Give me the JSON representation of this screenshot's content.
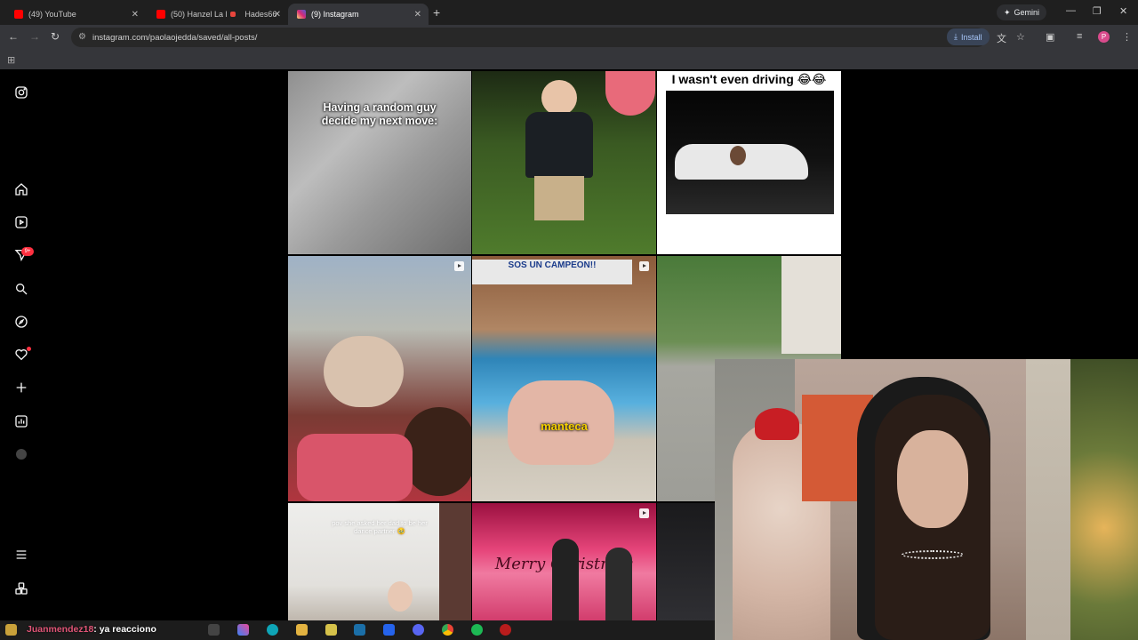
{
  "browser": {
    "tabs": [
      {
        "title": "(49) YouTube",
        "color": "#ff0000"
      },
      {
        "title": "(50) Hanzel La H",
        "color": "#ff0000"
      },
      {
        "title": "Hades66 -",
        "color": "#e8453c"
      },
      {
        "title": "(9) Instagram",
        "color": "#d6249f"
      }
    ],
    "gemini_label": "Gemini",
    "url": "instagram.com/paolaojedda/saved/all-posts/",
    "install_label": "Install",
    "profile_initial": "P"
  },
  "instagram": {
    "nav_badge": "9+",
    "posts": [
      {
        "caption": "Having a random guy decide my next move:"
      },
      {
        "caption": ""
      },
      {
        "caption": "I wasn't even driving 😂😂"
      },
      {
        "caption": ""
      },
      {
        "caption": "SOS UN CAMPEON!!"
      },
      {
        "caption": "manteca"
      },
      {
        "caption": ""
      },
      {
        "caption": "pov she asked her dad to be her dance partner 🥹"
      },
      {
        "caption": "Merry Christmas"
      }
    ]
  },
  "stream": {
    "chat_user": "Juanmendez18",
    "chat_message": ": ya reacciono"
  },
  "colors": {
    "ig_background": "#000000",
    "badge_red": "#ff3040",
    "chat_user": "#e05577"
  }
}
